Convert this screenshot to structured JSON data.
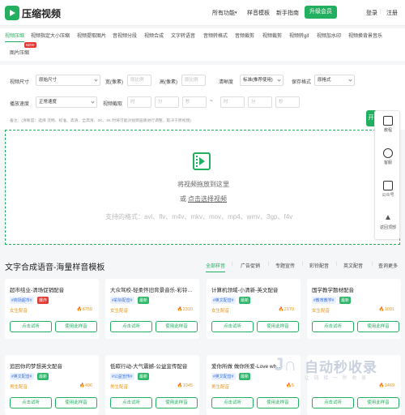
{
  "header": {
    "logo": "压缩视频",
    "nav": [
      "所有功能",
      "样音模板",
      "新手指南"
    ],
    "upgrade": "升级会员",
    "login": "登录",
    "register": "注册"
  },
  "tabs": [
    "视频压缩",
    "视频指定大小压缩",
    "视频提取图片",
    "音视频分段",
    "视频合成",
    "文字转语音",
    "音频转格式",
    "音频裁剪",
    "视频裁剪",
    "视频转gif",
    "视频加水印",
    "视频换背景音乐",
    "图片压缩"
  ],
  "new_badge": "NEW",
  "form": {
    "size_label": "视频尺寸",
    "size_value": "原始尺寸",
    "width_label": "宽(像素)",
    "width_ph": "原比例",
    "height_label": "高(像素)",
    "height_ph": "原比例",
    "clarity_label": "清晰度",
    "clarity_value": "标准(推荐使用)",
    "keep_label": "保存格式",
    "keep_value": "原格式",
    "speed_label": "播放速度",
    "speed_value": "正常速度",
    "clip_label": "视频截取",
    "t_hour": "时",
    "t_min": "分",
    "t_sec": "秒",
    "tilde": "~",
    "note": "备注：(清晰度：选择 流畅、标准、高清、全高清、2K、4K 时将可能对视频画质进行调整，取决于原视频)"
  },
  "start": "开",
  "drop": {
    "text": "将视频拖放到这里",
    "or": "或",
    "choose": "点击选择视频",
    "formats": "支持的格式：avi、flv、m4v、mkv、mov、mp4、wmv、3gp、f4v"
  },
  "side": [
    {
      "label": "教程"
    },
    {
      "label": "客服"
    },
    {
      "label": "公众号"
    },
    {
      "label": "返回顶部"
    }
  ],
  "section": {
    "title": "文字合成语音-海量样音模板",
    "tabs": [
      "全部样音",
      "广告促销",
      "专题宣传",
      "彩铃配音",
      "英文配音",
      "查询更多"
    ]
  },
  "cards": [
    {
      "title": "超市结业-清场促销配音",
      "tag": "#商场超市#",
      "hot": "爆炸",
      "hot_color": "#e53935",
      "voice": "女生配音",
      "count": "6759"
    },
    {
      "title": "大众驾校-轻柔怀旧背景音乐-彩铃…",
      "tag": "#彩铃配音#",
      "hot": "最新",
      "hot_color": "#2db86a",
      "voice": "女生配音",
      "count": "2310"
    },
    {
      "title": "计算机领域-小清新-英文配音",
      "tag": "#英文配音#",
      "hot": "最新",
      "hot_color": "#2db86a",
      "voice": "女生配音",
      "count": "2170"
    },
    {
      "title": "国学教学题材配音",
      "tag": "#教育教学#",
      "hot": "最新",
      "hot_color": "#2db86a",
      "voice": "女生配音",
      "count": "1091"
    },
    {
      "title": "追回你的梦想英文配音",
      "tag": "#英文配音#",
      "hot": "最新",
      "hot_color": "#2db86a",
      "voice": "男生配音",
      "count": "496"
    },
    {
      "title": "低碳行动-大气震撼-公益宣传配音",
      "tag": "#公益宣传#",
      "hot": "最新",
      "hot_color": "#2db86a",
      "voice": "男生配音",
      "count": "1045"
    },
    {
      "title": "爱你所做 做你所爱-Love wh…",
      "tag": "#英文配音#",
      "hot": "最新",
      "hot_color": "#2db86a",
      "voice": "男生配音",
      "count": "5"
    },
    {
      "title": "",
      "tag": "",
      "hot": "",
      "hot_color": "#2db86a",
      "voice": "",
      "count": "1469"
    }
  ],
  "card_buttons": {
    "listen": "点击试听",
    "use": "使用此样音"
  },
  "watermark": {
    "text": "自动秒收录",
    "sub": "让 链 接 一 秒 收 录"
  }
}
